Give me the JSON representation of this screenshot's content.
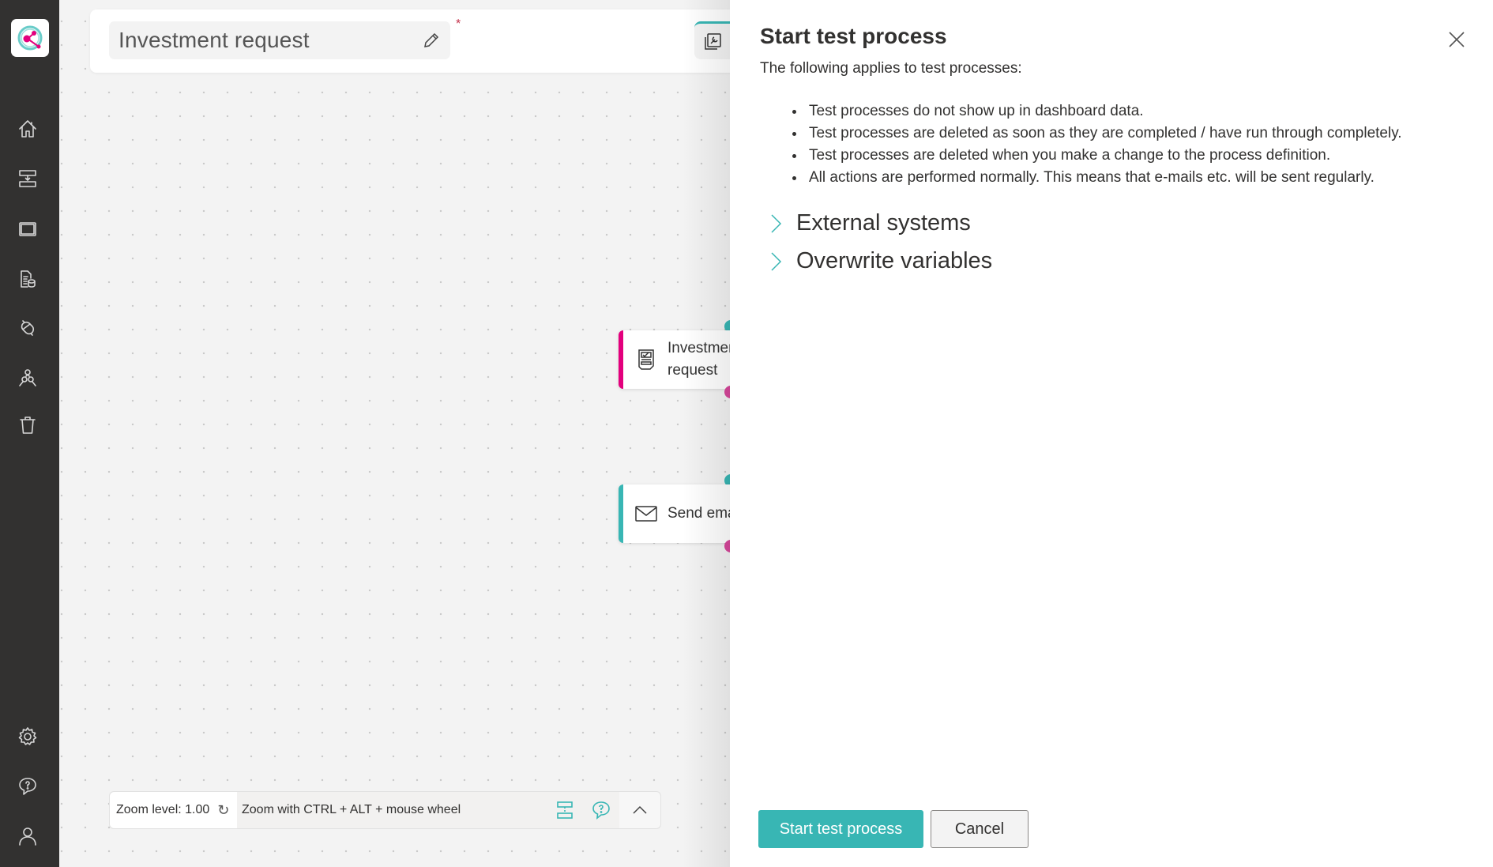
{
  "sidebar": {
    "logo": "app-logo",
    "top_items": [
      {
        "name": "home",
        "icon": "home-icon"
      },
      {
        "name": "processes",
        "icon": "process-icon"
      },
      {
        "name": "windows",
        "icon": "window-icon"
      },
      {
        "name": "data",
        "icon": "document-database-icon"
      },
      {
        "name": "integrations",
        "icon": "link-icon"
      },
      {
        "name": "users",
        "icon": "people-icon"
      },
      {
        "name": "trash",
        "icon": "trash-icon"
      }
    ],
    "bottom_items": [
      {
        "name": "settings",
        "icon": "gear-icon"
      },
      {
        "name": "help",
        "icon": "help-icon"
      },
      {
        "name": "profile",
        "icon": "user-icon"
      }
    ]
  },
  "editor": {
    "process_name": "Investment request",
    "required_marker": "*",
    "nodes": [
      {
        "label": "Investment\nrequest",
        "icon": "form-icon",
        "accent": "#e3007d"
      },
      {
        "label": "Send email",
        "icon": "mail-icon",
        "accent": "#38b6b4"
      }
    ],
    "zoom_bar": {
      "zoom_level": "Zoom level: 1.00",
      "hint": "Zoom with CTRL + ALT + mouse wheel"
    }
  },
  "panel": {
    "title": "Start test process",
    "subtitle": "The following applies to test processes:",
    "bullets": [
      "Test processes do not show up in dashboard data.",
      "Test processes are deleted as soon as they are completed / have run through completely.",
      "Test processes are deleted when you make a change to the process definition.",
      "All actions are performed normally. This means that e-mails etc. will be sent regularly."
    ],
    "sections": [
      {
        "label": "External systems",
        "expanded": false
      },
      {
        "label": "Overwrite variables",
        "expanded": false
      }
    ],
    "primary_button": "Start test process",
    "cancel_button": "Cancel"
  },
  "colors": {
    "accent_teal": "#38b6b4",
    "accent_magenta": "#e3007d",
    "sidebar_bg": "#323130"
  }
}
